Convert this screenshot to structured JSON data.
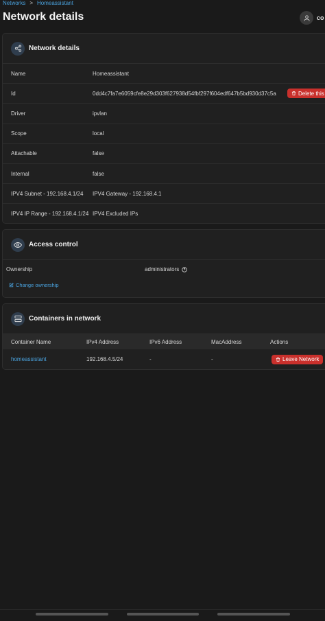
{
  "breadcrumb": {
    "parent": "Networks",
    "separator": ">",
    "current": "Homeassistant"
  },
  "page_title": "Network details",
  "user": {
    "name": "co"
  },
  "network_card": {
    "title": "Network details",
    "rows": [
      {
        "label": "Name",
        "value": "Homeassistant"
      },
      {
        "label": "Id",
        "value": "0dd4c7fa7e6059cfe8e29d303f627938d54fbf297f604edf647b5bd930d37c5a",
        "action": "Delete this"
      },
      {
        "label": "Driver",
        "value": "ipvlan"
      },
      {
        "label": "Scope",
        "value": "local"
      },
      {
        "label": "Attachable",
        "value": "false"
      },
      {
        "label": "Internal",
        "value": "false"
      },
      {
        "label": "IPV4 Subnet - 192.168.4.1/24",
        "value": "IPV4 Gateway - 192.168.4.1"
      },
      {
        "label": "IPV4 IP Range - 192.168.4.1/24",
        "value": "IPV4 Excluded IPs"
      }
    ]
  },
  "access_card": {
    "title": "Access control",
    "ownership_label": "Ownership",
    "ownership_value": "administrators",
    "change_link": "Change ownership"
  },
  "containers_card": {
    "title": "Containers in network",
    "columns": [
      "Container Name",
      "IPv4 Address",
      "IPv6 Address",
      "MacAddress",
      "Actions"
    ],
    "rows": [
      {
        "name": "homeassistant",
        "ipv4": "192.168.4.5/24",
        "ipv6": "-",
        "mac": "-",
        "action": "Leave Network"
      }
    ]
  },
  "colors": {
    "accent": "#4aa3df",
    "danger": "#c9302c",
    "background": "#1a1a1a",
    "card": "#202020"
  },
  "icons": [
    "share-icon",
    "eye-icon",
    "server-icon",
    "trash-icon",
    "edit-icon",
    "help-icon",
    "user-icon"
  ]
}
